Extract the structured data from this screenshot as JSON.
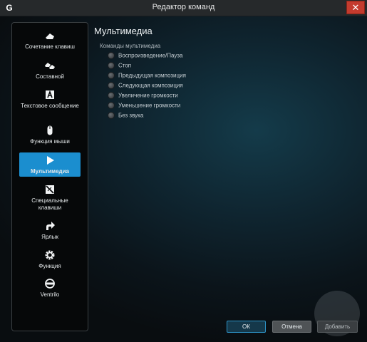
{
  "window": {
    "title": "Редактор команд",
    "close_glyph": "✕",
    "logo_glyph": "G"
  },
  "sidebar": {
    "items": [
      {
        "label": "Сочетание клавиш",
        "icon": "keystroke-icon"
      },
      {
        "label": "Составной",
        "icon": "multikey-icon"
      },
      {
        "label": "Текстовое сообщение",
        "icon": "text-block-icon"
      },
      {
        "label": "Функция мыши",
        "icon": "mouse-icon"
      },
      {
        "label": "Мультимедиа",
        "icon": "play-icon",
        "active": true
      },
      {
        "label": "Специальные клавиши",
        "icon": "hotkey-icon"
      },
      {
        "label": "Ярлык",
        "icon": "shortcut-arrow-icon"
      },
      {
        "label": "Функция",
        "icon": "gear-icon"
      },
      {
        "label": "Ventrilo",
        "icon": "headset-icon"
      }
    ]
  },
  "main": {
    "heading": "Мультимедиа",
    "section_title": "Команды мультимедиа",
    "options": [
      "Воспроизведение/Пауза",
      "Стоп",
      "Предыдущая композиция",
      "Следующая композиция",
      "Увеличение громкости",
      "Уменьшение громкости",
      "Без звука"
    ]
  },
  "buttons": {
    "ok": "ОК",
    "cancel": "Отмена",
    "add": "Добавить"
  },
  "colors": {
    "accent": "#1b8ecf",
    "close": "#c43b2e"
  }
}
